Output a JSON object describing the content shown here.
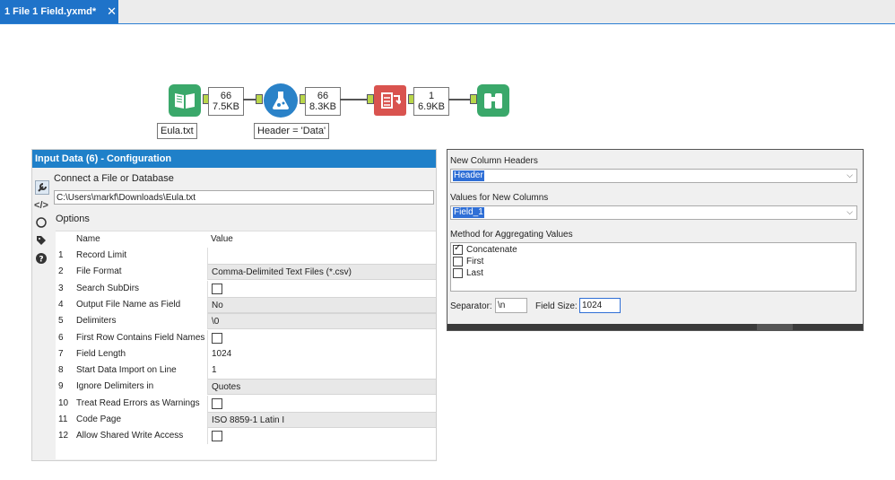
{
  "tab": {
    "title": "1 File 1 Field.yxmd*",
    "close": "✕"
  },
  "canvas": {
    "count1": {
      "records": "66",
      "size": "7.5KB"
    },
    "count2": {
      "records": "66",
      "size": "8.3KB"
    },
    "count3": {
      "records": "1",
      "size": "6.9KB"
    },
    "annotation1": "Eula.txt",
    "annotation2": "Header = 'Data'",
    "colors": {
      "input": "#3aa86a",
      "formula": "#2a82c8",
      "crosstab": "#d9534f",
      "browse": "#3aa86a"
    },
    "icons": [
      "book-icon",
      "flask-icon",
      "crosstab-icon",
      "binoculars-icon"
    ]
  },
  "config": {
    "title": "Input Data (6) - Configuration",
    "connect_label": "Connect a File or Database",
    "path": "C:\\Users\\markf\\Downloads\\Eula.txt",
    "options_label": "Options",
    "col_name": "Name",
    "col_value": "Value",
    "rows": [
      {
        "num": "1",
        "name": "Record Limit",
        "value": "",
        "checkbox": false
      },
      {
        "num": "2",
        "name": "File Format",
        "value": "Comma-Delimited Text Files (*.csv)",
        "checkbox": false
      },
      {
        "num": "3",
        "name": "Search SubDirs",
        "value": "",
        "checkbox": true
      },
      {
        "num": "4",
        "name": "Output File Name as Field",
        "value": "No",
        "checkbox": false
      },
      {
        "num": "5",
        "name": "Delimiters",
        "value": "\\0",
        "checkbox": false
      },
      {
        "num": "6",
        "name": "First Row Contains Field Names",
        "value": "",
        "checkbox": true
      },
      {
        "num": "7",
        "name": "Field Length",
        "value": "1024",
        "checkbox": false
      },
      {
        "num": "8",
        "name": "Start Data Import on Line",
        "value": "1",
        "checkbox": false
      },
      {
        "num": "9",
        "name": "Ignore Delimiters in",
        "value": "Quotes",
        "checkbox": false
      },
      {
        "num": "10",
        "name": "Treat Read Errors as Warnings",
        "value": "",
        "checkbox": true
      },
      {
        "num": "11",
        "name": "Code Page",
        "value": "ISO 8859-1 Latin I",
        "checkbox": false
      },
      {
        "num": "12",
        "name": "Allow Shared Write Access",
        "value": "",
        "checkbox": true
      }
    ],
    "sidebar_icons": [
      "wrench-icon",
      "code-icon",
      "navigate-icon",
      "tag-icon",
      "help-icon"
    ]
  },
  "crosstab": {
    "headers_label": "New Column Headers",
    "headers_value": "Header",
    "values_label": "Values for New Columns",
    "values_value": "Field_1",
    "method_label": "Method for Aggregating Values",
    "methods": [
      {
        "label": "Concatenate",
        "checked": true
      },
      {
        "label": "First",
        "checked": false
      },
      {
        "label": "Last",
        "checked": false
      }
    ],
    "separator_label": "Separator:",
    "separator_value": "\\n",
    "fieldsize_label": "Field Size:",
    "fieldsize_value": "1024"
  }
}
